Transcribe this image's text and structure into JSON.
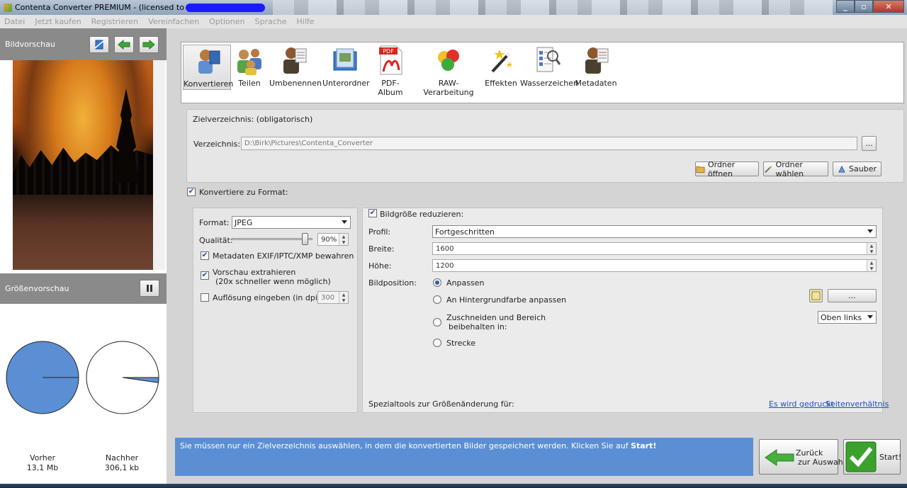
{
  "window": {
    "title": "Contenta Converter PREMIUM  - (licensed to"
  },
  "menu": [
    "Datei",
    "Jetzt kaufen",
    "Registrieren",
    "Vereinfachen",
    "Optionen",
    "Sprache",
    "Hilfe"
  ],
  "left_panel": {
    "preview_header": "Bildvorschau",
    "size_header": "Größenvorschau",
    "before_label": "Vorher",
    "before_size": "13,1 Mb",
    "after_label": "Nachher",
    "after_size": "306,1 kb",
    "after_fraction": 0.0228
  },
  "tools": [
    "Konvertieren",
    "Teilen",
    "Umbenennen",
    "Unterordner",
    "PDF-Album",
    "RAW-Verarbeitung",
    "Effekten",
    "Wasserzeichen",
    "Metadaten"
  ],
  "pdf_badge": "PDF",
  "target": {
    "section_title": "Zielverzeichnis: (obligatorisch)",
    "dir_label": "Verzeichnis:",
    "dir_value": "D:\\Birk\\Pictures\\Contenta_Converter",
    "browse_label": "...",
    "open_folder": "Ordner öffnen",
    "choose_folder": "Ordner wählen",
    "clean": "Sauber"
  },
  "convert": {
    "checkbox_label": "Konvertiere zu Format:",
    "format_label": "Format:",
    "format_value": "JPEG",
    "quality_label": "Qualität:",
    "quality_value": "90%",
    "quality_fraction": 0.9,
    "metadata_label": "Metadaten EXIF/IPTC/XMP bewahren",
    "preview_extract_line1": "Vorschau extrahieren",
    "preview_extract_line2": "(20x schneller wenn möglich)",
    "resolution_label": "Auflösung eingeben (in dpi):",
    "resolution_value": "300"
  },
  "resize": {
    "checkbox_label": "Bildgröße reduzieren:",
    "profile_label": "Profil:",
    "profile_value": "Fortgeschritten",
    "width_label": "Breite:",
    "width_value": "1600",
    "height_label": "Höhe:",
    "height_value": "1200",
    "position_label": "Bildposition:",
    "opt_fit": "Anpassen",
    "opt_bg": "An Hintergrundfarbe anpassen",
    "opt_crop_line1": "Zuschneiden und Bereich",
    "opt_crop_line2": "beibehalten in:",
    "opt_stretch": "Strecke",
    "bg_button": "...",
    "crop_value": "Oben links",
    "special_label": "Spezialtools zur Größenänderung für:",
    "link_print": "Es wird gedruckt",
    "link_ratio": "Seitenverhältnis"
  },
  "hint": {
    "text": "Sie müssen nur ein Zielverzeichnis auswählen, in dem die konvertierten Bilder gespeichert werden. Klicken Sie auf ",
    "bold": "Start!"
  },
  "back_button": {
    "line1": "Zurück",
    "line2": "zur Auswahl"
  },
  "start_button": "Start!",
  "colors": {
    "hint_bg": "#5b8fd4",
    "pie": "#5b8fd4",
    "link": "#1f4fbf"
  }
}
